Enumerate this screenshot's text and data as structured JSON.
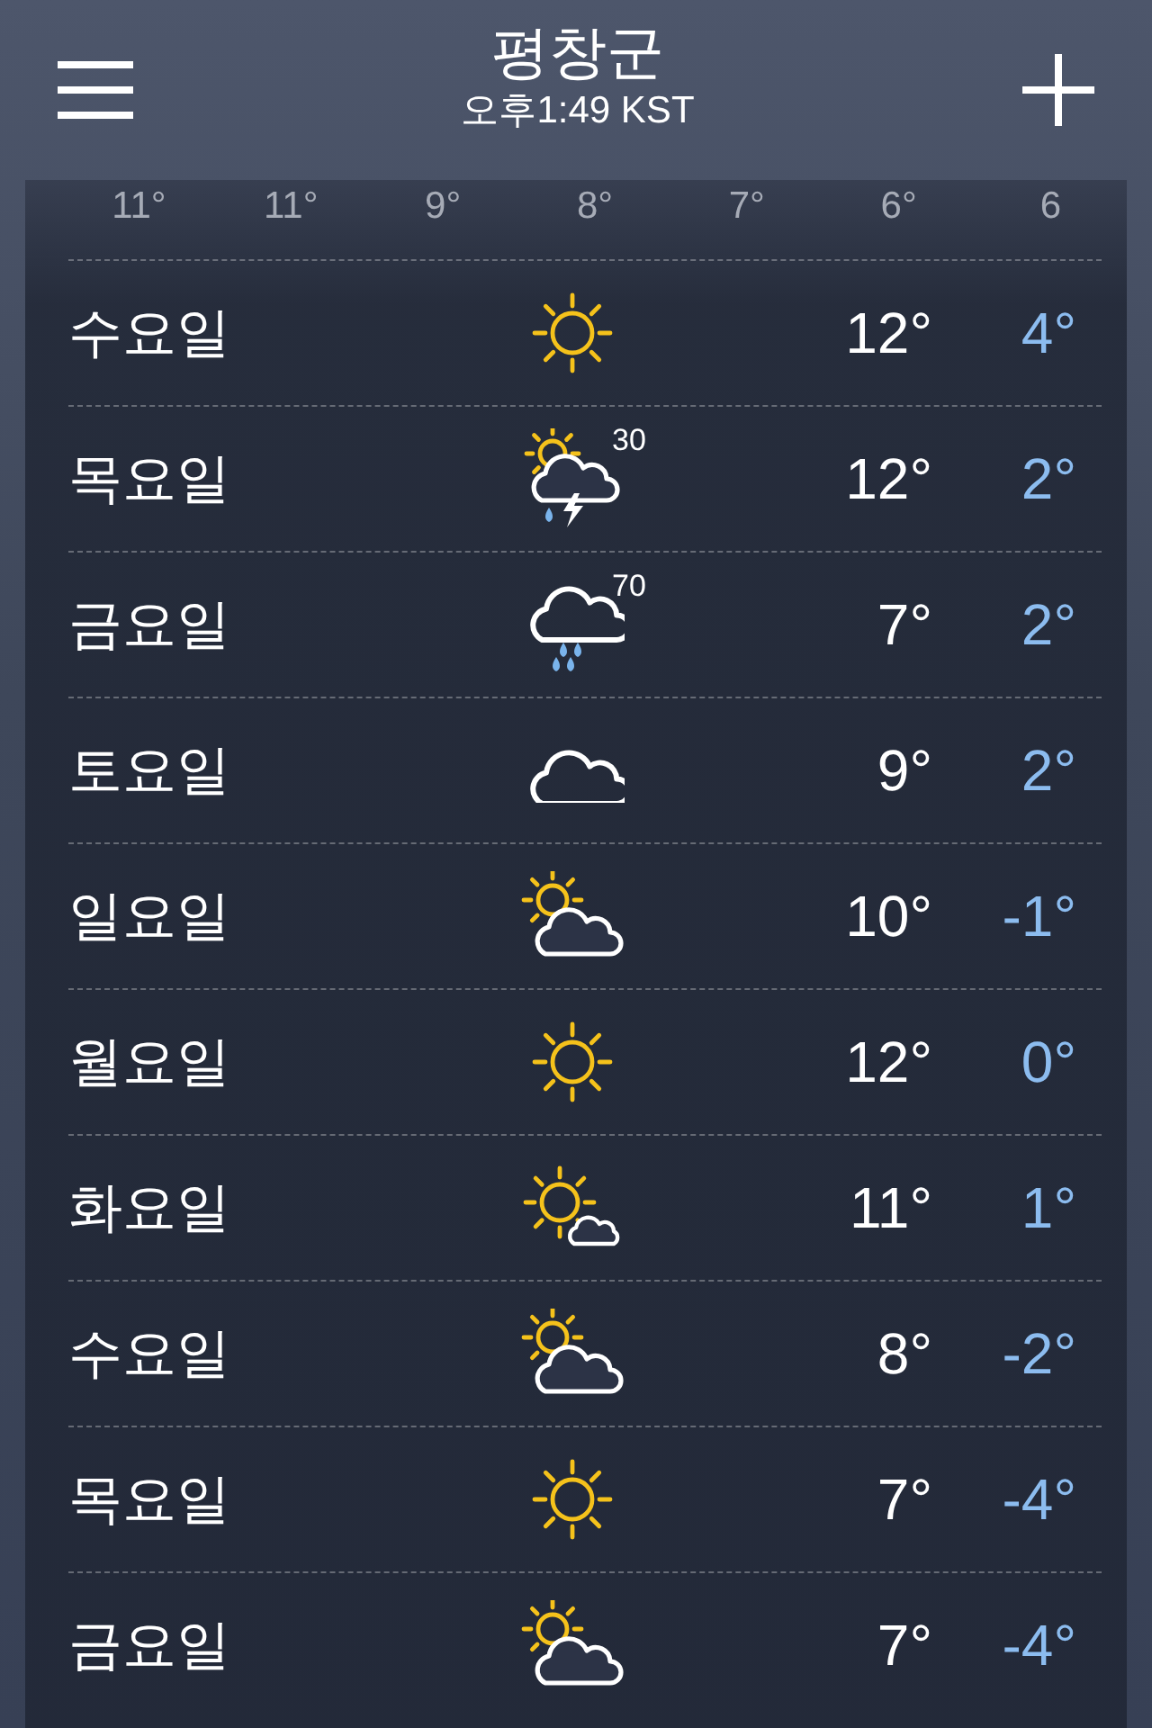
{
  "header": {
    "city": "평창군",
    "time": "오후1:49 KST"
  },
  "hourly": [
    "11°",
    "11°",
    "9°",
    "8°",
    "7°",
    "6°",
    "6"
  ],
  "days": [
    {
      "day": "수요일",
      "kind": "sunny",
      "high": "12°",
      "low": "4°"
    },
    {
      "day": "목요일",
      "kind": "thunder",
      "chance": "30",
      "high": "12°",
      "low": "2°"
    },
    {
      "day": "금요일",
      "kind": "rain",
      "chance": "70",
      "high": "7°",
      "low": "2°"
    },
    {
      "day": "토요일",
      "kind": "cloudy",
      "high": "9°",
      "low": "2°"
    },
    {
      "day": "일요일",
      "kind": "partly",
      "high": "10°",
      "low": "-1°"
    },
    {
      "day": "월요일",
      "kind": "sunny",
      "high": "12°",
      "low": "0°"
    },
    {
      "day": "화요일",
      "kind": "mostly_sunny",
      "high": "11°",
      "low": "1°"
    },
    {
      "day": "수요일",
      "kind": "partly",
      "high": "8°",
      "low": "-2°"
    },
    {
      "day": "목요일",
      "kind": "sunny",
      "high": "7°",
      "low": "-4°"
    },
    {
      "day": "금요일",
      "kind": "partly",
      "high": "7°",
      "low": "-4°"
    }
  ]
}
